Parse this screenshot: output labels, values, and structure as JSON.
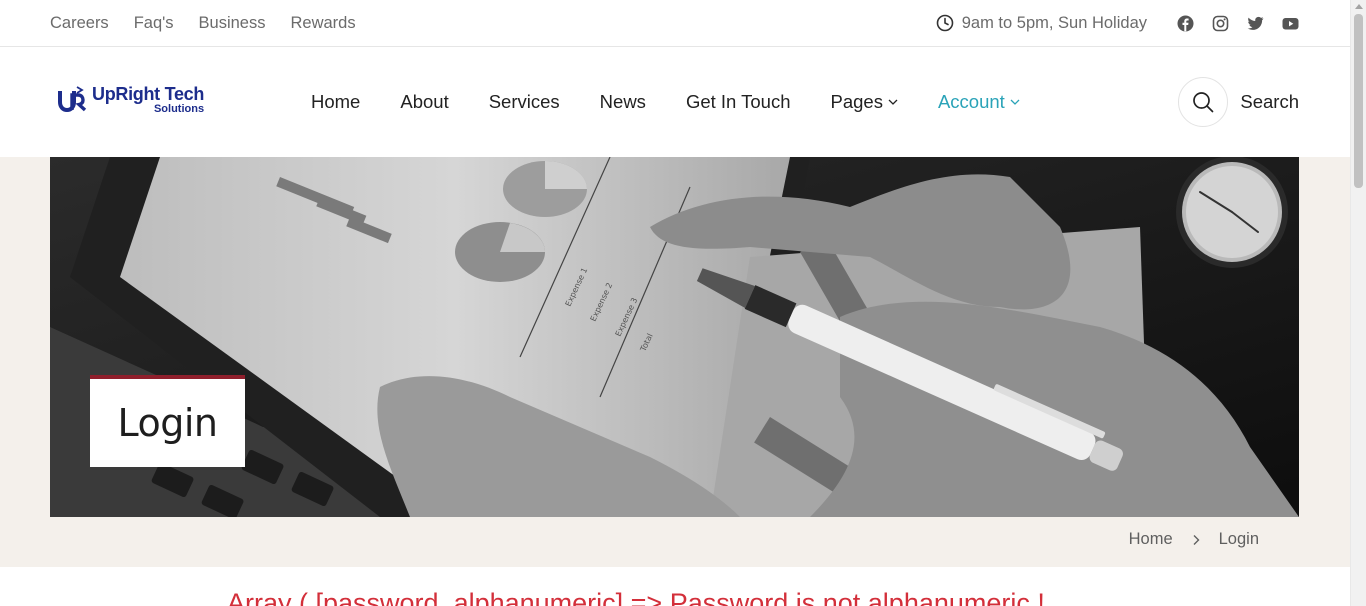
{
  "topbar": {
    "links": [
      "Careers",
      "Faq's",
      "Business",
      "Rewards"
    ],
    "hours": "9am to 5pm, Sun Holiday",
    "social_icons": [
      "facebook-icon",
      "instagram-icon",
      "twitter-icon",
      "youtube-icon"
    ]
  },
  "logo": {
    "main": "UpRight Tech",
    "sub": "Solutions"
  },
  "nav": {
    "items": [
      "Home",
      "About",
      "Services",
      "News",
      "Get In Touch",
      "Pages",
      "Account"
    ],
    "active": "Account"
  },
  "search": {
    "label": "Search"
  },
  "hero": {
    "title": "Login"
  },
  "breadcrumb": {
    "home": "Home",
    "current": "Login"
  },
  "error": {
    "text": "Array ( [password_alphanumeric] => Password is not alphanumeric !"
  },
  "colors": {
    "accent": "#2aa3b8",
    "brand": "#1d2d8c",
    "login_bar": "#8f1f2c",
    "error": "#d32f3a",
    "hero_bg": "#f4f0eb"
  }
}
